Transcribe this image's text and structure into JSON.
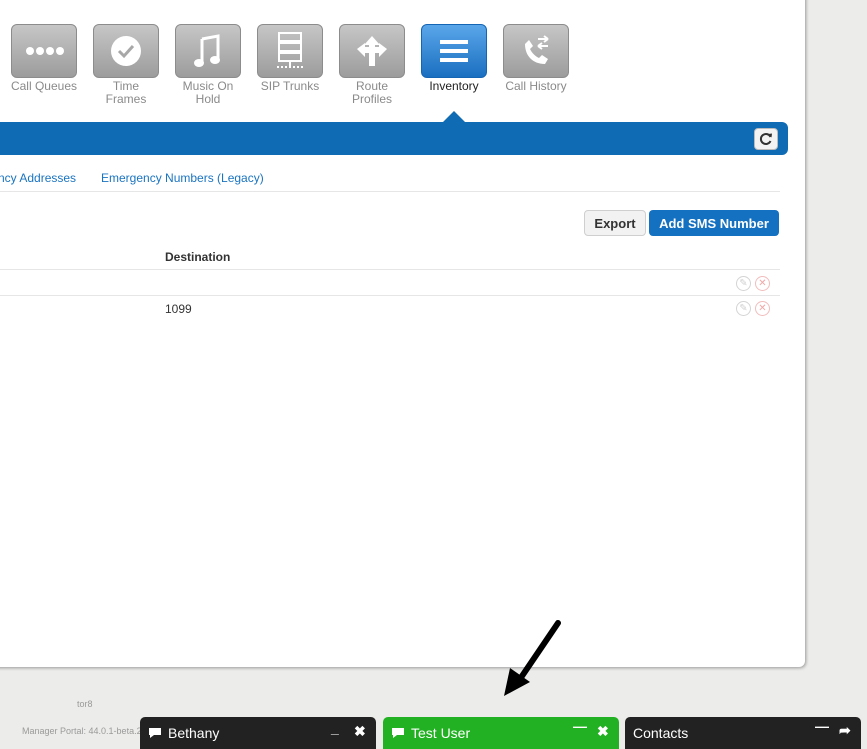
{
  "nav": {
    "tiles": [
      {
        "label": "Call Queues",
        "icon": "dots-icon"
      },
      {
        "label": "Time Frames",
        "icon": "clock-icon"
      },
      {
        "label": "Music On Hold",
        "icon": "music-note-icon"
      },
      {
        "label": "SIP Trunks",
        "icon": "server-icon"
      },
      {
        "label": "Route Profiles",
        "icon": "route-arrows-icon"
      },
      {
        "label": "Inventory",
        "icon": "list-icon",
        "active": true
      },
      {
        "label": "Call History",
        "icon": "phone-history-icon"
      }
    ]
  },
  "subnav": {
    "link1": "ncy Addresses",
    "link2": "Emergency Numbers (Legacy)"
  },
  "toolbar": {
    "export_label": "Export",
    "add_label": "Add SMS Number"
  },
  "table": {
    "header_destination": "Destination",
    "rows": [
      {
        "destination": ""
      },
      {
        "destination": "1099"
      }
    ]
  },
  "footer": {
    "server": "tor8",
    "version": "Manager Portal: 44.0.1-beta.2"
  },
  "chat": {
    "bethany": {
      "title": "Bethany",
      "color": "#222222"
    },
    "test_user": {
      "title": "Test User",
      "color": "#22b122"
    },
    "contacts": {
      "title": "Contacts",
      "color": "#222222"
    }
  },
  "colors": {
    "accent": "#0f6bb4",
    "primary_button": "#1470c0"
  }
}
